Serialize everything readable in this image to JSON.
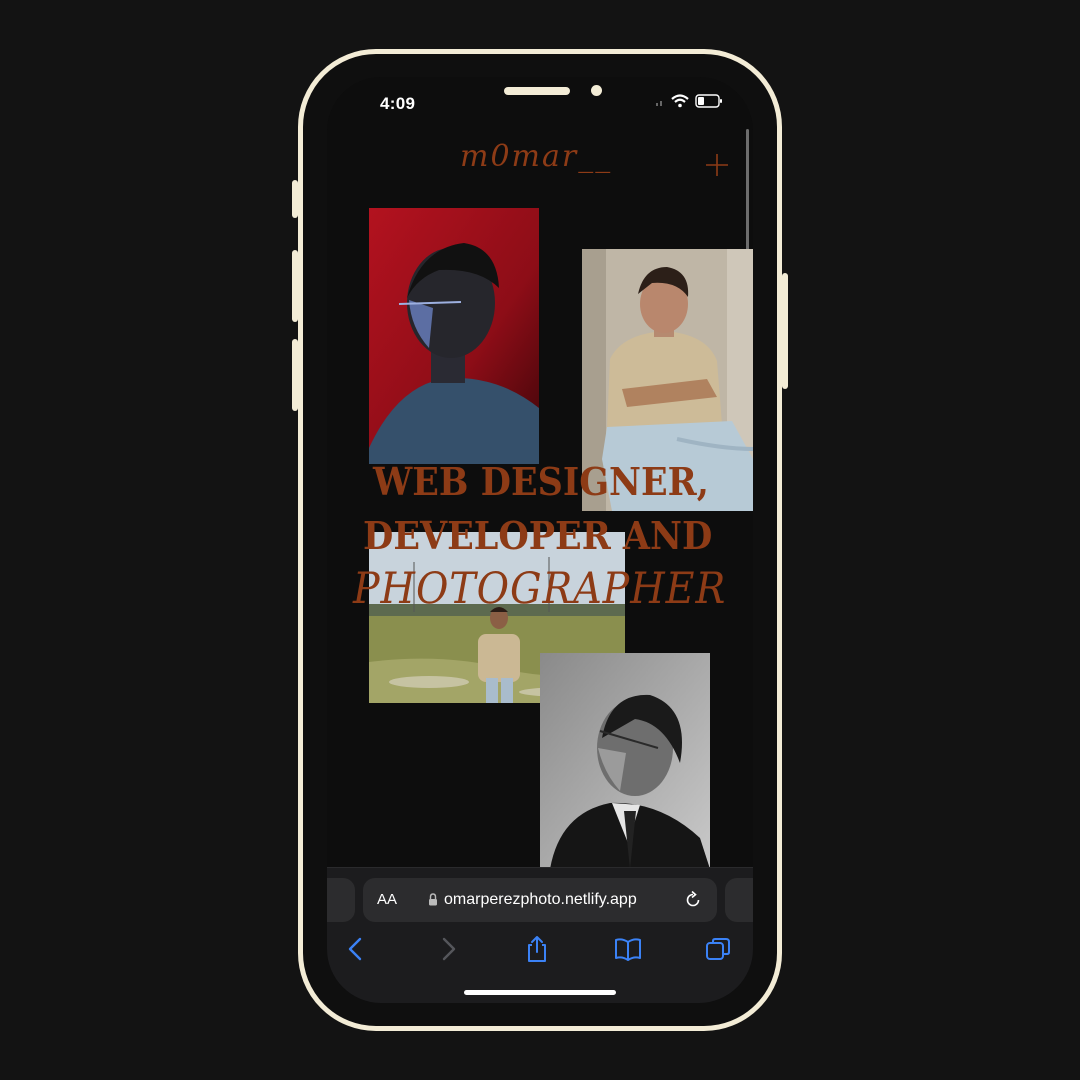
{
  "status": {
    "time": "4:09"
  },
  "site": {
    "logo": "m0mar__",
    "headline": {
      "line1": "WEB DESIGNER,",
      "line2": "DEVELOPER AND",
      "line3": "PHOTOGRAPHER"
    },
    "photos": [
      {
        "name": "red-portrait-photo"
      },
      {
        "name": "seated-portrait-photo"
      },
      {
        "name": "field-portrait-photo"
      },
      {
        "name": "bw-portrait-photo"
      }
    ]
  },
  "browser": {
    "aa_label": "AA",
    "url": "omarperezphoto.netlify.app",
    "toolbar": [
      "back-icon",
      "forward-icon",
      "share-icon",
      "bookmarks-icon",
      "tabs-icon"
    ]
  },
  "colors": {
    "accent": "#8d3b16",
    "frame": "#f3ecd6",
    "safari_blue": "#3b82f6"
  }
}
